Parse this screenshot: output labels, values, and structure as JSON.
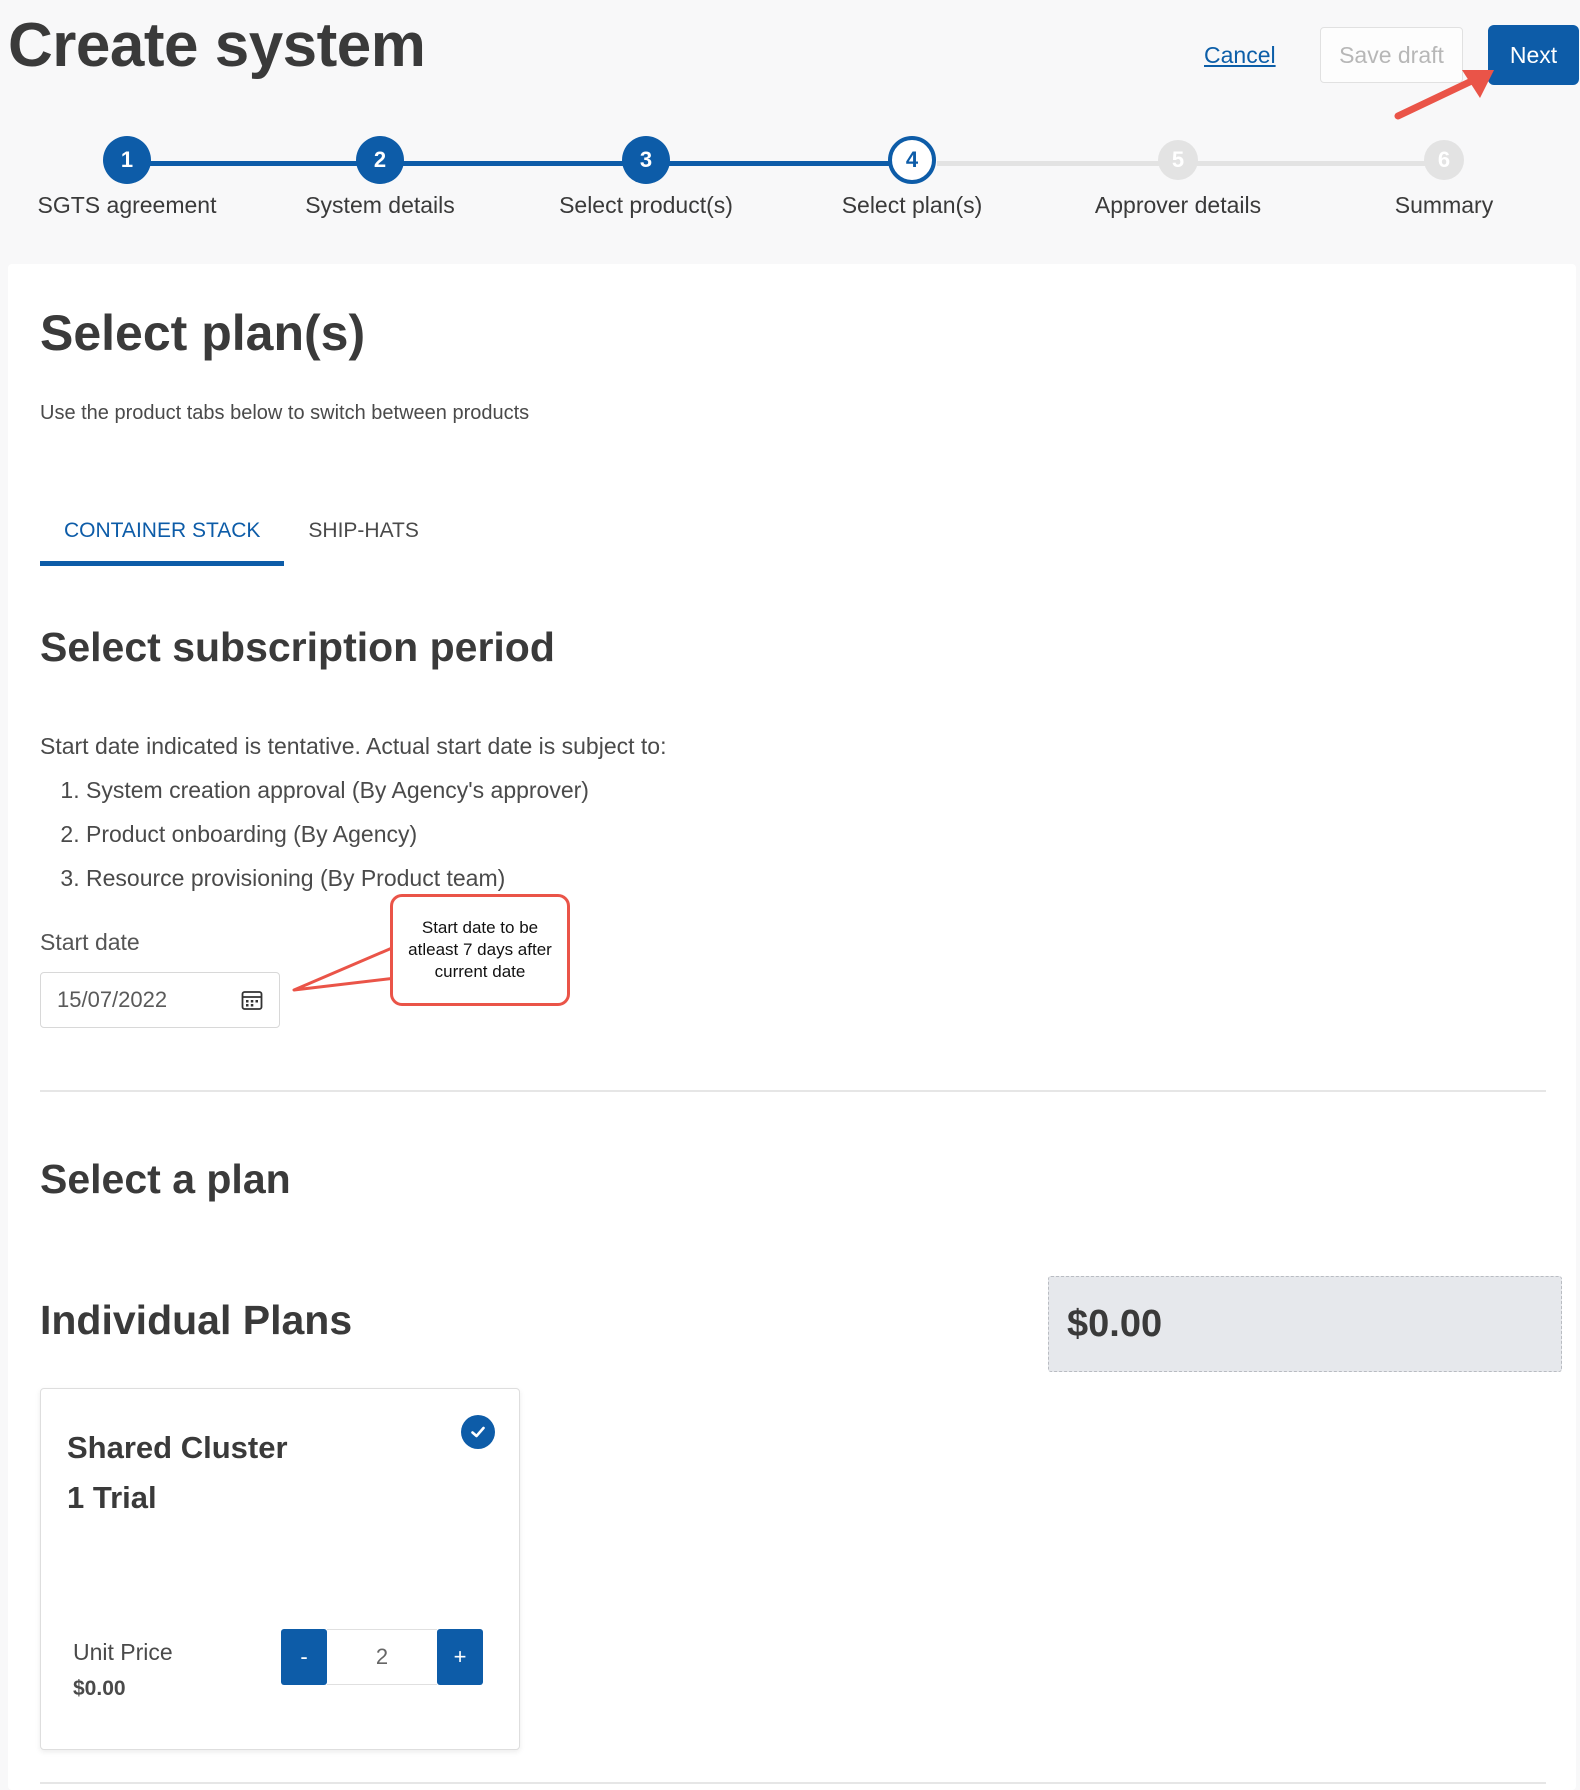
{
  "header": {
    "title": "Create system",
    "cancel_label": "Cancel",
    "save_draft_label": "Save draft",
    "next_label": "Next"
  },
  "stepper": {
    "steps": [
      {
        "number": "1",
        "label": "SGTS agreement",
        "state": "done"
      },
      {
        "number": "2",
        "label": "System details",
        "state": "done"
      },
      {
        "number": "3",
        "label": "Select product(s)",
        "state": "done"
      },
      {
        "number": "4",
        "label": "Select plan(s)",
        "state": "current"
      },
      {
        "number": "5",
        "label": "Approver details",
        "state": "todo"
      },
      {
        "number": "6",
        "label": "Summary",
        "state": "todo"
      }
    ]
  },
  "main": {
    "title": "Select plan(s)",
    "subtitle": "Use the product tabs below to switch between products",
    "tabs": [
      {
        "label": "CONTAINER STACK",
        "active": true
      },
      {
        "label": "SHIP-HATS",
        "active": false
      }
    ],
    "subscription": {
      "title": "Select subscription period",
      "intro": "Start date indicated is tentative. Actual start date is subject to:",
      "conditions": [
        "System creation approval (By Agency's approver)",
        "Product onboarding (By Agency)",
        "Resource provisioning (By Product team)"
      ],
      "start_date_label": "Start date",
      "start_date_value": "15/07/2022",
      "callout": "Start date to be atleast 7 days after current date"
    },
    "plan_section": {
      "title": "Select a plan",
      "group_title": "Individual Plans",
      "total": "$0.00",
      "plans": [
        {
          "name": "Shared Cluster",
          "subtitle": "1 Trial",
          "selected": true,
          "unit_price_label": "Unit Price",
          "unit_price": "$0.00",
          "decrement_label": "-",
          "quantity": "2",
          "increment_label": "+"
        }
      ]
    }
  },
  "colors": {
    "primary": "#0d5ca8",
    "annotation": "#ea5448",
    "inactive_step": "#e3e3e3"
  }
}
